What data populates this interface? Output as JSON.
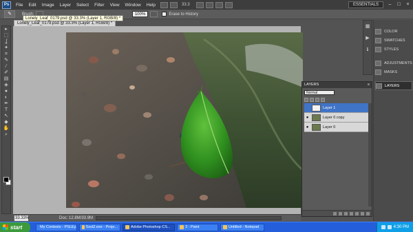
{
  "menubar": {
    "logo": "Ps",
    "items": [
      "File",
      "Edit",
      "Image",
      "Layer",
      "Select",
      "Filter",
      "View",
      "Window",
      "Help"
    ],
    "zoom": "33.3",
    "workspace": "ESSENTIALS",
    "window_buttons": [
      "–",
      "□",
      "×"
    ]
  },
  "options": {
    "tool_icon": "brush-icon",
    "brush_label": "Brush:",
    "flow_value": "100%",
    "erase_to_history": "Erase to History"
  },
  "tooltip": "Lonely_Leaf_0179.psd @ 33.3% (Layer 1, RGB/8) *",
  "document": {
    "tab": "Lonely_Leaf_0179.psd @ 33.3% (Layer 1, RGB/8) *"
  },
  "tools": [
    "▸",
    "⬚",
    "ʆ",
    "✦",
    "⌗",
    "✎",
    "⁄",
    "✐",
    "▤",
    "◈",
    "●",
    "◐",
    "✒",
    "T",
    "↖",
    "◆",
    "✋",
    "⌕"
  ],
  "status": {
    "zoom": "33.33%",
    "doc": "Doc: 12.8M/33.9M"
  },
  "dock": {
    "items": [
      {
        "label": "COLOR",
        "icon": "color-icon"
      },
      {
        "label": "SWATCHES",
        "icon": "swatches-icon"
      },
      {
        "label": "STYLES",
        "icon": "styles-icon"
      },
      {
        "label": "ADJUSTMENTS",
        "icon": "adjustments-icon"
      },
      {
        "label": "MASKS",
        "icon": "masks-icon"
      },
      {
        "label": "LAYERS",
        "icon": "layers-icon"
      }
    ]
  },
  "layers": {
    "title": "LAYERS",
    "blend_mode": "Normal",
    "rows": [
      {
        "name": "Layer 1",
        "selected": true,
        "thumb": "white"
      },
      {
        "name": "Layer 0 copy",
        "selected": false,
        "thumb": "photo"
      },
      {
        "name": "Layer 0",
        "selected": false,
        "thumb": "photo"
      }
    ]
  },
  "taskbar": {
    "start": "start",
    "tasks": [
      {
        "label": "My Contests - PSLEy..."
      },
      {
        "label": "Ssst2.exe - Proje..."
      },
      {
        "label": "Adobe Photoshop CS..."
      },
      {
        "label": "3 - Paint"
      },
      {
        "label": "Untitled - Notepad"
      }
    ],
    "clock": "4:30 PM"
  },
  "colors": {
    "ui_dark": "#3d3d3d",
    "selection": "#3f74c7",
    "taskbar": "#245edb",
    "start": "#3c9a3c"
  }
}
